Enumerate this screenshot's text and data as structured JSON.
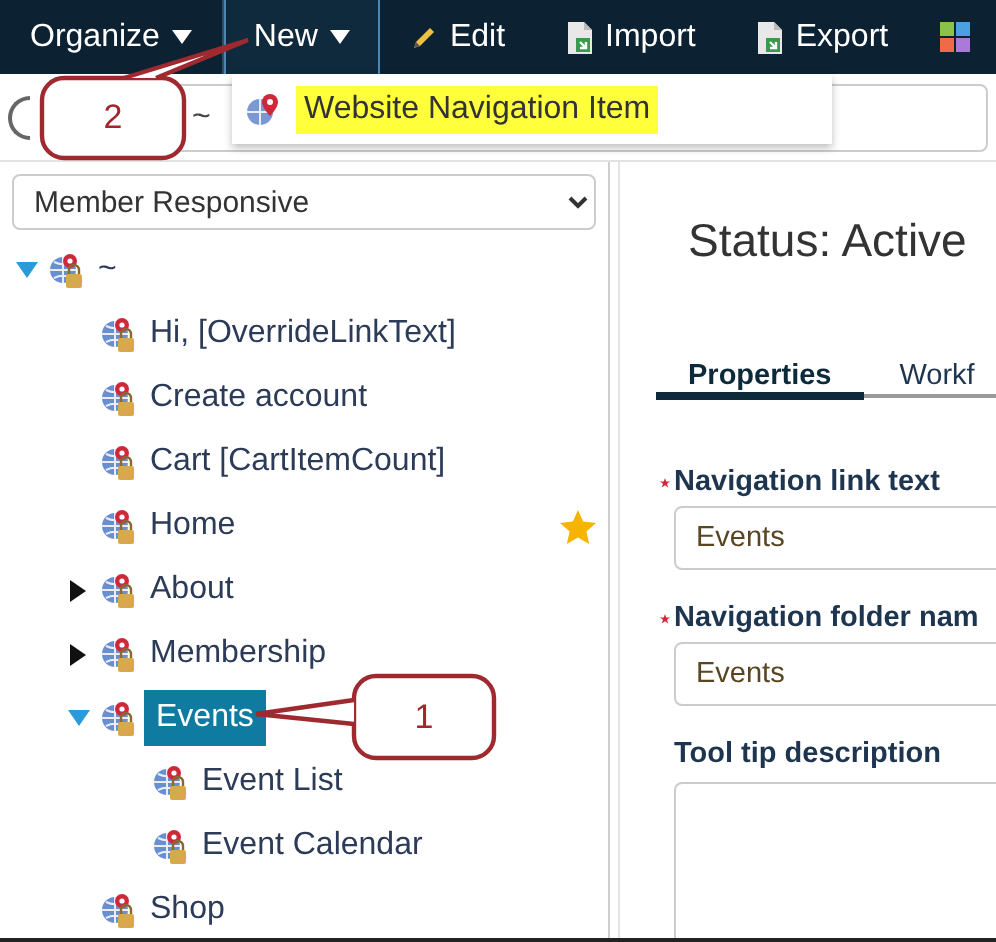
{
  "toolbar": {
    "items": [
      {
        "kind": "dropdown",
        "label": "Organize",
        "active": false
      },
      {
        "kind": "dropdown",
        "label": "New",
        "active": true
      },
      {
        "kind": "edit",
        "label": "Edit",
        "active": false
      },
      {
        "kind": "import",
        "label": "Import",
        "active": false
      },
      {
        "kind": "export",
        "label": "Export",
        "active": false
      },
      {
        "kind": "apps",
        "active": false
      }
    ]
  },
  "new_menu": {
    "items": [
      {
        "label": "Website Navigation Item",
        "highlighted": true
      }
    ]
  },
  "path_field": {
    "value": "~"
  },
  "site_select": {
    "value": "Member Responsive"
  },
  "tree": [
    {
      "label": "~",
      "kind": "folder",
      "expanded": true,
      "selected": false,
      "starred": false,
      "children": [
        {
          "label": "Hi, [OverrideLinkText]",
          "kind": "item",
          "selected": false,
          "starred": false
        },
        {
          "label": "Create account",
          "kind": "item",
          "selected": false,
          "starred": false
        },
        {
          "label": "Cart [CartItemCount]",
          "kind": "item",
          "selected": false,
          "starred": false
        },
        {
          "label": "Home",
          "kind": "item",
          "selected": false,
          "starred": true
        },
        {
          "label": "About",
          "kind": "folder",
          "expanded": false,
          "selected": false,
          "starred": false
        },
        {
          "label": "Membership",
          "kind": "folder",
          "expanded": false,
          "selected": false,
          "starred": false
        },
        {
          "label": "Events",
          "kind": "folder",
          "expanded": true,
          "selected": true,
          "starred": false,
          "children": [
            {
              "label": "Event List",
              "kind": "item",
              "selected": false,
              "starred": false
            },
            {
              "label": "Event Calendar",
              "kind": "item",
              "selected": false,
              "starred": false
            }
          ]
        },
        {
          "label": "Shop",
          "kind": "item",
          "selected": false,
          "starred": false
        }
      ]
    }
  ],
  "details": {
    "status": "Status: Active",
    "tabs": [
      {
        "label": "Properties",
        "selected": true
      },
      {
        "label": "Workf",
        "selected": false
      }
    ],
    "fields": [
      {
        "label": "Navigation link text",
        "required": true,
        "value": "Events",
        "kind": "text"
      },
      {
        "label": "Navigation folder nam",
        "required": true,
        "value": "Events",
        "kind": "text"
      },
      {
        "label": "Tool tip description",
        "required": false,
        "kind": "textarea"
      }
    ]
  },
  "callouts": [
    {
      "label": "2"
    },
    {
      "label": "1"
    }
  ]
}
